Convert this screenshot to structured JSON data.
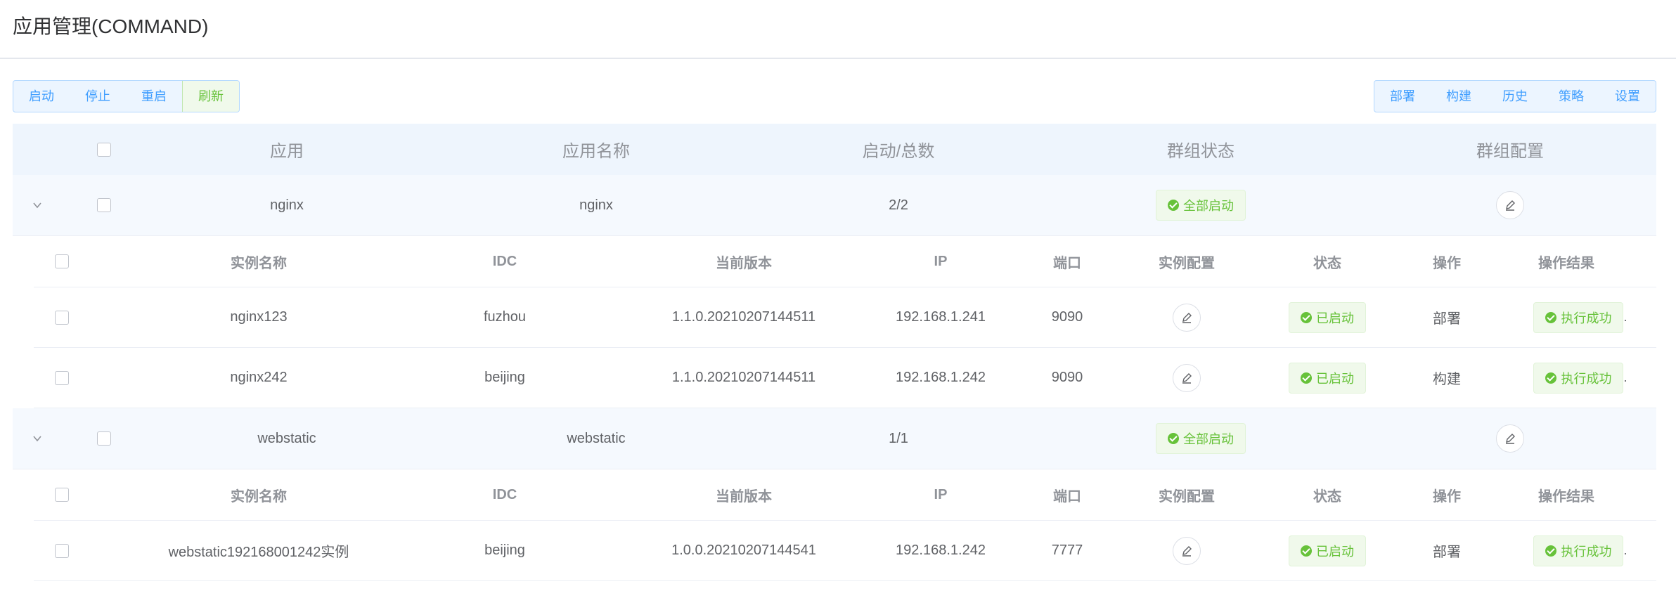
{
  "page": {
    "title": "应用管理(COMMAND)"
  },
  "toolbar_left": {
    "start": "启动",
    "stop": "停止",
    "restart": "重启",
    "refresh": "刷新"
  },
  "toolbar_right": {
    "deploy": "部署",
    "build": "构建",
    "history": "历史",
    "strategy": "策略",
    "settings": "设置"
  },
  "table": {
    "headers": {
      "app": "应用",
      "app_name": "应用名称",
      "started_total": "启动/总数",
      "group_status": "群组状态",
      "group_config": "群组配置"
    },
    "sub_headers": {
      "instance_name": "实例名称",
      "idc": "IDC",
      "version": "当前版本",
      "ip": "IP",
      "port": "端口",
      "instance_config": "实例配置",
      "status": "状态",
      "operation": "操作",
      "result": "操作结果"
    },
    "groups": [
      {
        "app": "nginx",
        "app_name": "nginx",
        "count": "2/2",
        "status": "全部启动",
        "instances": [
          {
            "name": "nginx123",
            "idc": "fuzhou",
            "version": "1.1.0.20210207144511",
            "ip": "192.168.1.241",
            "port": "9090",
            "status": "已启动",
            "operation": "部署",
            "result": "执行成功"
          },
          {
            "name": "nginx242",
            "idc": "beijing",
            "version": "1.1.0.20210207144511",
            "ip": "192.168.1.242",
            "port": "9090",
            "status": "已启动",
            "operation": "构建",
            "result": "执行成功"
          }
        ]
      },
      {
        "app": "webstatic",
        "app_name": "webstatic",
        "count": "1/1",
        "status": "全部启动",
        "instances": [
          {
            "name": "webstatic192168001242实例",
            "idc": "beijing",
            "version": "1.0.0.20210207144541",
            "ip": "192.168.1.242",
            "port": "7777",
            "status": "已启动",
            "operation": "部署",
            "result": "执行成功"
          }
        ]
      }
    ]
  },
  "colors": {
    "primary": "#409eff",
    "success": "#67c23a",
    "header_bg": "#eef5fd",
    "row_bg": "#f5f9fe"
  }
}
